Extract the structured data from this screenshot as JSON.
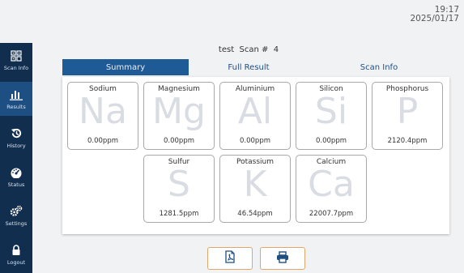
{
  "clock": {
    "time": "19:17",
    "date": "2025/01/17"
  },
  "sidebar": {
    "items": [
      {
        "label": "Scan Info",
        "icon": "scan-grid-icon",
        "active": false
      },
      {
        "label": "Results",
        "icon": "bar-chart-icon",
        "active": true
      },
      {
        "label": "History",
        "icon": "history-icon",
        "active": false
      },
      {
        "label": "Status",
        "icon": "gauge-icon",
        "active": false
      },
      {
        "label": "Settings",
        "icon": "gears-icon",
        "active": false
      },
      {
        "label": "Logout",
        "icon": "lock-icon",
        "active": false
      }
    ]
  },
  "header": {
    "scan_title": "test  Scan #  4"
  },
  "tabs": [
    {
      "label": "Summary",
      "active": true
    },
    {
      "label": "Full Result",
      "active": false
    },
    {
      "label": "Scan Info",
      "active": false
    }
  ],
  "elements": [
    {
      "name": "Sodium",
      "symbol": "Na",
      "value": "0.00ppm"
    },
    {
      "name": "Magnesium",
      "symbol": "Mg",
      "value": "0.00ppm"
    },
    {
      "name": "Aluminium",
      "symbol": "Al",
      "value": "0.00ppm"
    },
    {
      "name": "Silicon",
      "symbol": "Si",
      "value": "0.00ppm"
    },
    {
      "name": "Phosphorus",
      "symbol": "P",
      "value": "2120.4ppm"
    },
    {
      "name": "Sulfur",
      "symbol": "S",
      "value": "1281.5ppm"
    },
    {
      "name": "Potassium",
      "symbol": "K",
      "value": "46.54ppm"
    },
    {
      "name": "Calcium",
      "symbol": "Ca",
      "value": "22007.7ppm"
    }
  ],
  "actions": [
    {
      "icon": "pdf-export-icon"
    },
    {
      "icon": "printer-icon"
    }
  ],
  "colors": {
    "sidebar_bg": "#122e4f",
    "active_tab": "#1e5a96",
    "button_border": "#e0a66a",
    "symbol_watermark": "#d9dde3"
  }
}
